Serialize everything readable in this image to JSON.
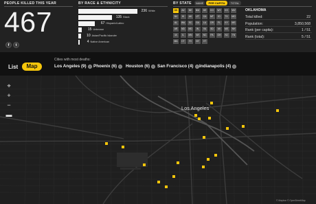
{
  "header": {
    "people_killed_title": "PEOPLE KILLED THIS YEAR",
    "total_killed": "467",
    "race_title": "BY RACE & ETHNICITY",
    "state_title": "BY STATE"
  },
  "social": {
    "facebook_glyph": "f",
    "twitter_glyph": "t"
  },
  "race": [
    {
      "count": "236",
      "label": "White"
    },
    {
      "count": "135",
      "label": "Black"
    },
    {
      "count": "67",
      "label": "Hispanic/Latino"
    },
    {
      "count": "15",
      "label": "Unknown"
    },
    {
      "count": "10",
      "label": "Asian/Pacific Islander"
    },
    {
      "count": "4",
      "label": "Native American"
    }
  ],
  "race_share": [
    236,
    135,
    67,
    15,
    10,
    4
  ],
  "state_toggle": {
    "name": "NAME",
    "per_capita": "PER CAPITA",
    "total": "TOTAL",
    "active": "per_capita"
  },
  "states": [
    [
      "OK",
      "AZ",
      "NE",
      "NM",
      "DE",
      "CO",
      "WY",
      "KS",
      "WV"
    ],
    [
      "NV",
      "HI",
      "AK",
      "UT",
      "CA",
      "MT",
      "ID",
      "TX",
      "MO"
    ],
    [
      "AL",
      "WA",
      "SC",
      "GA",
      "LA",
      "OR",
      "FL",
      "KY",
      "MS"
    ],
    [
      "AR",
      "ND",
      "MD",
      "IN",
      "VA",
      "SD",
      "MI",
      "ME",
      "NH"
    ],
    [
      "IA",
      "IL",
      "MN",
      "WI",
      "NC",
      "PA",
      "OH",
      "NJ",
      "TN"
    ],
    [
      "MA",
      "CT",
      "RI",
      "NY",
      "VT"
    ]
  ],
  "selected_state": "OK",
  "state_detail": {
    "name": "OKLAHOMA",
    "rows": [
      {
        "label": "Total killed:",
        "value": "22"
      },
      {
        "label": "Population:",
        "value": "3,850,568"
      },
      {
        "label": "Rank (per capita):",
        "value": "1 / 51"
      },
      {
        "label": "Rank (total):",
        "value": "5 / 51"
      }
    ]
  },
  "view_toggle": {
    "list": "List",
    "map": "Map",
    "active": "map"
  },
  "cities_label": "Cities with most deaths:",
  "cities": [
    "Los Angeles (9)",
    "Phoenix (6)",
    "Houston (6)",
    "San Francisco (4)",
    "Indianapolis (4)"
  ],
  "map": {
    "city_label": "Los Angeles",
    "attribution": "© Mapbox © OpenStreetMap",
    "zoom_in": "+",
    "zoom_out": "−",
    "marker_color": "#f6c60b"
  },
  "colors": {
    "accent": "#f6c60b",
    "panel": "#222222",
    "map_bg": "#1f1f1f"
  }
}
